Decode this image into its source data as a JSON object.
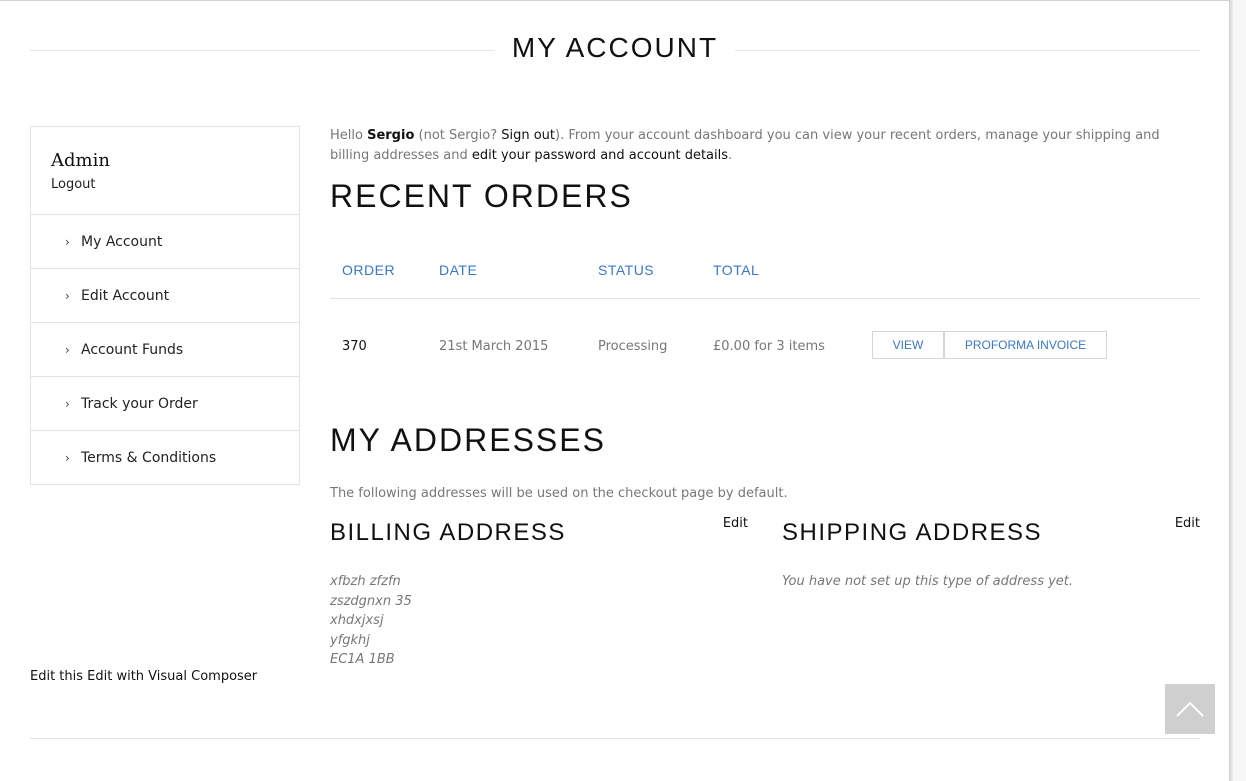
{
  "page": {
    "title": "MY ACCOUNT"
  },
  "sidebar": {
    "user_name": "Admin",
    "logout_label": "Logout",
    "items": [
      {
        "label": "My Account"
      },
      {
        "label": "Edit Account"
      },
      {
        "label": "Account Funds"
      },
      {
        "label": "Track your Order"
      },
      {
        "label": "Terms & Conditions"
      }
    ]
  },
  "intro": {
    "hello": "Hello ",
    "name": "Sergio",
    "not_prefix": " (not Sergio? ",
    "sign_out": "Sign out",
    "middle": "). From your account dashboard you can view your recent orders, manage your shipping and billing addresses and ",
    "edit_link": "edit your password and account details",
    "end": "."
  },
  "recent_orders": {
    "heading": "RECENT ORDERS",
    "columns": [
      "ORDER",
      "DATE",
      "STATUS",
      "TOTAL"
    ],
    "rows": [
      {
        "order": "370",
        "date": "21st March 2015",
        "status": "Processing",
        "total": "£0.00 for 3 items",
        "view_label": "VIEW",
        "invoice_label": "PROFORMA INVOICE"
      }
    ]
  },
  "addresses": {
    "heading": "MY ADDRESSES",
    "note": "The following addresses will be used on the checkout page by default.",
    "billing": {
      "title": "BILLING ADDRESS",
      "edit_label": "Edit",
      "lines": [
        "xfbzh zfzfn",
        "zszdgnxn 35",
        "xhdxjxsj",
        "yfgkhj",
        "EC1A 1BB"
      ]
    },
    "shipping": {
      "title": "SHIPPING ADDRESS",
      "edit_label": "Edit",
      "empty_text": "You have not set up this type of address yet."
    }
  },
  "footer": {
    "edit_links": "Edit this Edit with Visual Composer"
  },
  "icons": {
    "menu_chevron": "chevron-right-icon",
    "back_to_top": "chevron-up-icon"
  },
  "colors": {
    "link_blue": "#3a78c3",
    "to_top_bg": "#cfcfcf"
  }
}
